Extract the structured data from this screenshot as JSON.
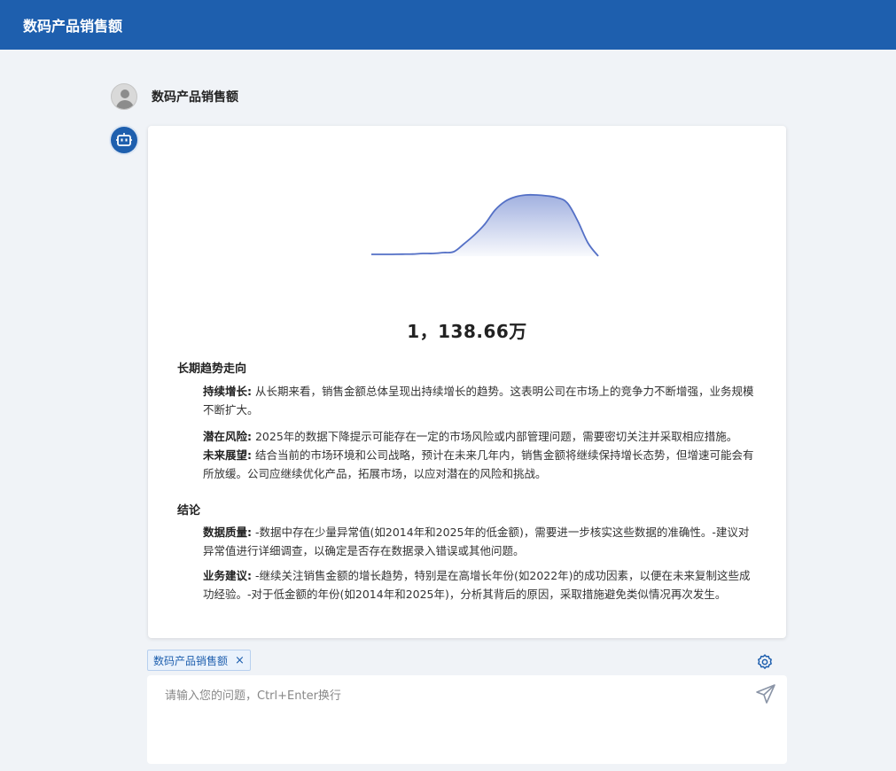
{
  "header": {
    "title": "数码产品销售额"
  },
  "user_message": {
    "text": "数码产品销售额"
  },
  "response": {
    "chart": {
      "type": "area",
      "color": "#5470c6"
    },
    "chart_data": {
      "type": "area",
      "x": [
        0,
        1,
        2,
        3,
        4,
        5,
        6,
        7,
        8,
        9,
        10,
        11,
        12,
        13,
        14,
        15,
        16,
        17,
        18,
        19,
        20,
        21,
        22
      ],
      "values": [
        2,
        2,
        2,
        2.2,
        2.3,
        3,
        3,
        4,
        5,
        14,
        24,
        36,
        52,
        62,
        67,
        69,
        69,
        68,
        66,
        60,
        40,
        15,
        0
      ],
      "ylim": [
        0,
        72
      ],
      "grid": false
    },
    "total_value": "1，138.66万",
    "sections": [
      {
        "title": "长期趋势走向",
        "items": [
          {
            "label": "持续增长:",
            "text": "从长期来看，销售金额总体呈现出持续增长的趋势。这表明公司在市场上的竞争力不断增强，业务规模不断扩大。"
          },
          {
            "label": "潜在风险:",
            "text": "2025年的数据下降提示可能存在一定的市场风险或内部管理问题，需要密切关注并采取相应措施。"
          },
          {
            "label": "未来展望:",
            "text": "结合当前的市场环境和公司战略，预计在未来几年内，销售金额将继续保持增长态势，但增速可能会有所放缓。公司应继续优化产品，拓展市场，以应对潜在的风险和挑战。"
          }
        ]
      },
      {
        "title": "结论",
        "items": [
          {
            "label": "数据质量:",
            "text": "-数据中存在少量异常值(如2014年和2025年的低金额)，需要进一步核实这些数据的准确性。-建议对异常值进行详细调查，以确定是否存在数据录入错误或其他问题。"
          },
          {
            "label": "业务建议:",
            "text": "-继续关注销售金额的增长趋势，特别是在高增长年份(如2022年)的成功因素，以便在未来复制这些成功经验。-对于低金额的年份(如2014年和2025年)，分析其背后的原因，采取措施避免类似情况再次发生。"
          }
        ]
      }
    ]
  },
  "context_tag": {
    "label": "数码产品销售额",
    "close": "×"
  },
  "composer": {
    "placeholder": "请输入您的问题，Ctrl+Enter换行",
    "value": ""
  },
  "icons": {
    "user": "user-avatar-icon",
    "bot": "robot-icon",
    "settings": "gear-icon",
    "send": "send-icon",
    "close": "close-icon"
  },
  "colors": {
    "header": "#1e5fae",
    "accent": "#1e5fae",
    "chart_line": "#5470c6"
  }
}
